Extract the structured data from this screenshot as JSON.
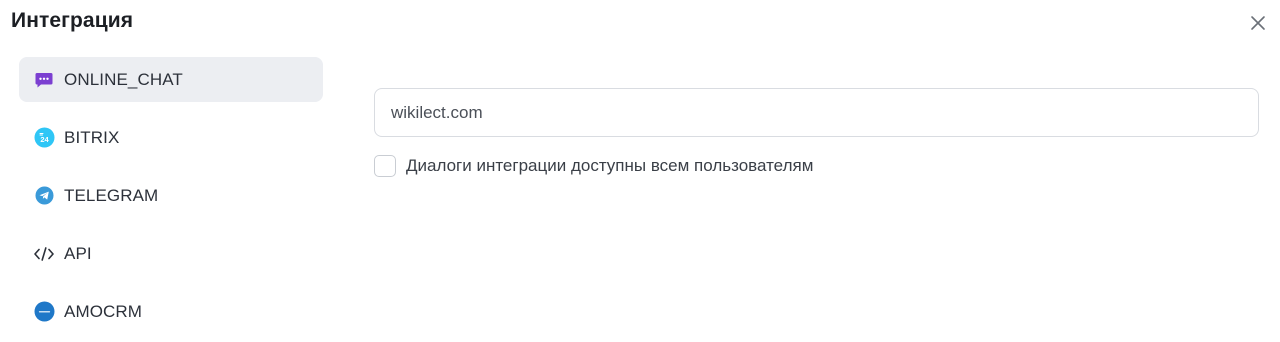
{
  "header": {
    "title": "Интеграция"
  },
  "sidebar": {
    "items": [
      {
        "label": "ONLINE_CHAT",
        "icon": "chat-bubble-icon",
        "active": true
      },
      {
        "label": "BITRIX",
        "icon": "bitrix24-icon",
        "active": false
      },
      {
        "label": "TELEGRAM",
        "icon": "telegram-icon",
        "active": false
      },
      {
        "label": "API",
        "icon": "code-icon",
        "active": false
      },
      {
        "label": "AMOCRM",
        "icon": "amocrm-icon",
        "active": false
      }
    ]
  },
  "main": {
    "domain_input": {
      "value": "wikilect.com"
    },
    "shared_dialogs": {
      "label": "Диалоги интеграции доступны всем пользователям",
      "checked": false
    }
  },
  "colors": {
    "active_item_bg": "#eceef2",
    "chat_icon": "#7b3fd1",
    "bitrix_icon": "#2fc6f6",
    "telegram_icon": "#3a9ad9",
    "amocrm_icon": "#1f78c8"
  }
}
